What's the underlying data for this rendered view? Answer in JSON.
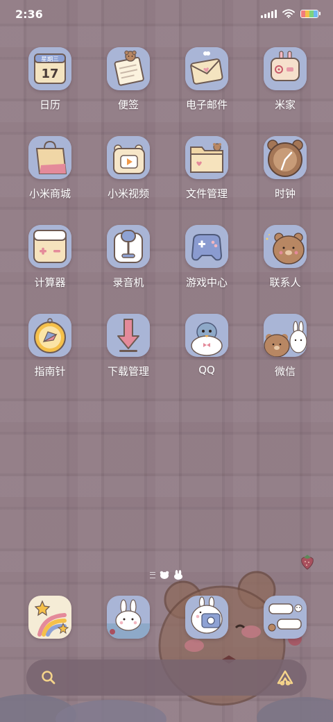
{
  "status_bar": {
    "time": "2:36",
    "icons": [
      "signal-icon",
      "wifi-icon",
      "battery-icon"
    ],
    "battery_colors": [
      "#f27b7b",
      "#f5c04a",
      "#7ed37e",
      "#6fb8f0"
    ]
  },
  "apps": [
    {
      "label": "日历",
      "icon": "calendar-icon",
      "calendar_weekday": "星期三",
      "calendar_day": "17"
    },
    {
      "label": "便签",
      "icon": "notes-icon"
    },
    {
      "label": "电子邮件",
      "icon": "email-icon"
    },
    {
      "label": "米家",
      "icon": "mijia-icon"
    },
    {
      "label": "小米商城",
      "icon": "shopping-bag-icon"
    },
    {
      "label": "小米视频",
      "icon": "video-icon"
    },
    {
      "label": "文件管理",
      "icon": "folder-icon"
    },
    {
      "label": "时钟",
      "icon": "clock-icon"
    },
    {
      "label": "计算器",
      "icon": "calculator-icon"
    },
    {
      "label": "录音机",
      "icon": "microphone-icon"
    },
    {
      "label": "游戏中心",
      "icon": "gamepad-icon"
    },
    {
      "label": "联系人",
      "icon": "contacts-bear-icon"
    },
    {
      "label": "指南针",
      "icon": "compass-icon"
    },
    {
      "label": "下载管理",
      "icon": "download-arrow-icon"
    },
    {
      "label": "QQ",
      "icon": "qq-penguin-icon"
    },
    {
      "label": "微信",
      "icon": "wechat-bear-bunny-icon"
    }
  ],
  "page_indicator": {
    "pages": 3,
    "active": 1
  },
  "dock": [
    {
      "icon": "star-rainbow-icon"
    },
    {
      "icon": "bunny-photo-icon"
    },
    {
      "icon": "bunny-camera-icon"
    },
    {
      "icon": "message-bubbles-icon"
    }
  ],
  "search_bar": {
    "icons": [
      "search-icon",
      "assistant-icon"
    ]
  },
  "colors": {
    "wallpaper": "#8e7882",
    "icon_background": "#a9b5d6",
    "search_bar": "#78646f",
    "label_text": "#ffffff"
  }
}
